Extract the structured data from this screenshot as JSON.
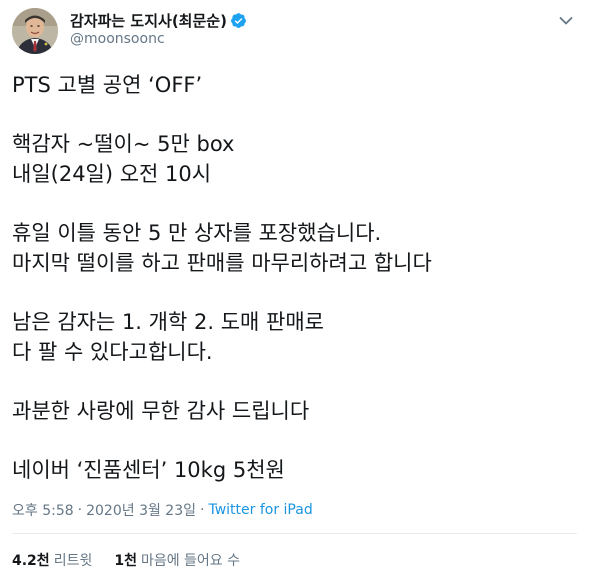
{
  "author": {
    "display_name": "감자파는 도지사(최문순)",
    "handle": "@moonsoonc",
    "verified": true,
    "verified_color": "#1da1f2"
  },
  "icons": {
    "verified": "verified-badge-icon",
    "more": "chevron-down-icon"
  },
  "tweet": {
    "paragraphs": [
      [
        "PTS 고별 공연 ‘OFF’"
      ],
      [
        "핵감자 ~떨이~ 5만 box",
        "내일(24일) 오전 10시"
      ],
      [
        "휴일 이틀 동안 5 만 상자를 포장했습니다.",
        "마지막 떨이를 하고 판매를 마무리하려고 합니다"
      ],
      [
        "남은 감자는 1. 개학 2. 도매 판매로",
        "다 팔 수 있다고합니다."
      ],
      [
        "과분한 사랑에 무한 감사 드립니다"
      ],
      [
        "네이버 ‘진품센터’ 10kg 5천원"
      ]
    ]
  },
  "meta": {
    "time": "오후 5:58",
    "separator": "·",
    "date": "2020년 3월 23일",
    "source": "Twitter for iPad"
  },
  "stats": {
    "retweets_count": "4.2천",
    "retweets_label": "리트윗",
    "likes_count": "1천",
    "likes_label": "마음에 들어요 수"
  },
  "colors": {
    "link": "#1b95e0",
    "muted": "#657786",
    "text": "#14171a"
  }
}
